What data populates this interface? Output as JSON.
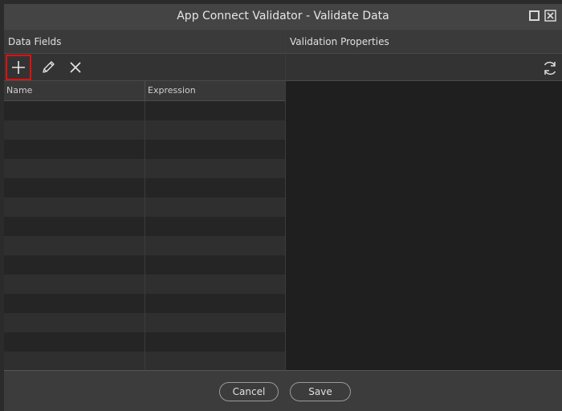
{
  "window": {
    "title": "App Connect Validator - Validate Data"
  },
  "left_panel": {
    "title": "Data Fields",
    "toolbar": [
      {
        "icon": "plus-icon",
        "action": "add"
      },
      {
        "icon": "pencil-icon",
        "action": "edit"
      },
      {
        "icon": "x-icon",
        "action": "delete"
      }
    ],
    "columns": [
      "Name",
      "Expression"
    ],
    "rows": [
      [
        "",
        ""
      ],
      [
        "",
        ""
      ],
      [
        "",
        ""
      ],
      [
        "",
        ""
      ],
      [
        "",
        ""
      ],
      [
        "",
        ""
      ],
      [
        "",
        ""
      ],
      [
        "",
        ""
      ],
      [
        "",
        ""
      ],
      [
        "",
        ""
      ],
      [
        "",
        ""
      ],
      [
        "",
        ""
      ],
      [
        "",
        ""
      ],
      [
        "",
        ""
      ]
    ]
  },
  "right_panel": {
    "title": "Validation Properties",
    "toolbar": [
      {
        "icon": "refresh-icon",
        "action": "refresh"
      }
    ]
  },
  "footer": {
    "cancel_label": "Cancel",
    "save_label": "Save"
  },
  "colors": {
    "highlight": "#e01010",
    "background": "#1f1f1f"
  }
}
